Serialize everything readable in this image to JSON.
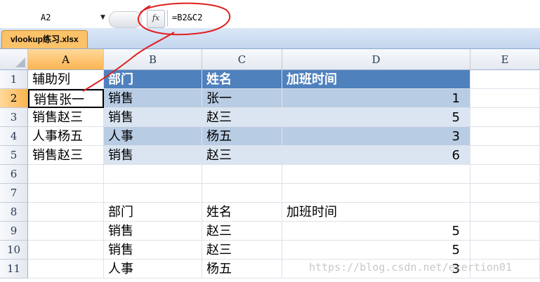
{
  "formula_bar": {
    "name_box": "A2",
    "fx_label": "fx",
    "formula": "=B2&C2"
  },
  "workbook": {
    "file_tab": "vlookup练习.xlsx"
  },
  "columns": [
    "A",
    "B",
    "C",
    "D",
    "E"
  ],
  "rows": [
    "1",
    "2",
    "3",
    "4",
    "5",
    "6",
    "7",
    "8",
    "9",
    "10",
    "11"
  ],
  "cells": {
    "A1": "辅助列",
    "B1": "部门",
    "C1": "姓名",
    "D1": "加班时间",
    "A2": "销售张一",
    "B2": "销售",
    "C2": "张一",
    "D2": "1",
    "A3": "销售赵三",
    "B3": "销售",
    "C3": "赵三",
    "D3": "5",
    "A4": "人事杨五",
    "B4": "人事",
    "C4": "杨五",
    "D4": "3",
    "A5": "销售赵三",
    "B5": "销售",
    "C5": "赵三",
    "D5": "6",
    "B8": "部门",
    "C8": "姓名",
    "D8": "加班时间",
    "B9": "销售",
    "C9": "赵三",
    "D9": "5",
    "B10": "销售",
    "C10": "赵三",
    "D10": "5",
    "B11": "人事",
    "C11": "杨五",
    "D11": "3"
  },
  "watermark": "https://blog.csdn.net/exertion01",
  "colors": {
    "table_header": "#4f81bd",
    "band_dark": "#b8cce4",
    "band_light": "#dbe5f1",
    "selected_header": "#fbb451",
    "annotation": "#e02020"
  }
}
